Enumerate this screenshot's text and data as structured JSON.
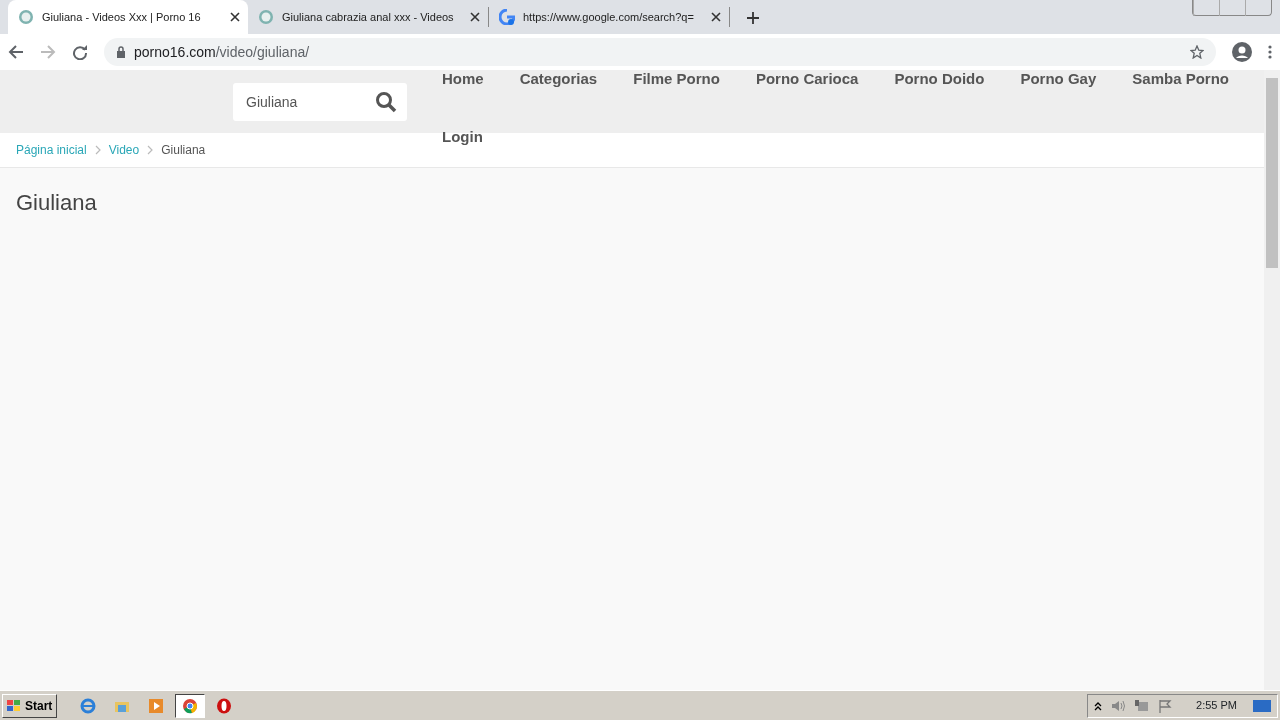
{
  "browser": {
    "tabs": [
      {
        "title": "Giuliana - Videos Xxx | Porno 16",
        "selected": true,
        "kind": "site"
      },
      {
        "title": "Giuliana cabrazia anal xxx - Videos",
        "selected": false,
        "kind": "site"
      },
      {
        "title": "https://www.google.com/search?q=",
        "selected": false,
        "kind": "google"
      }
    ],
    "address": {
      "domain": "porno16.com",
      "path": "/video/giuliana/"
    }
  },
  "header": {
    "search": {
      "value": "Giuliana"
    },
    "nav": [
      "Home",
      "Categorias",
      "Filme Porno",
      "Porno Carioca",
      "Porno Doido",
      "Porno Gay",
      "Samba Porno",
      "Login"
    ]
  },
  "breadcrumb": [
    {
      "label": "Página inicial",
      "link": true
    },
    {
      "label": "Video",
      "link": true
    },
    {
      "label": "Giuliana",
      "link": false
    }
  ],
  "page_title": "Giuliana",
  "taskbar": {
    "start": "Start",
    "apps": [
      {
        "kind": "ie",
        "active": false
      },
      {
        "kind": "explorer",
        "active": false
      },
      {
        "kind": "media",
        "active": false
      },
      {
        "kind": "chrome",
        "active": true
      },
      {
        "kind": "opera",
        "active": false
      }
    ],
    "time": "2:55 PM"
  }
}
